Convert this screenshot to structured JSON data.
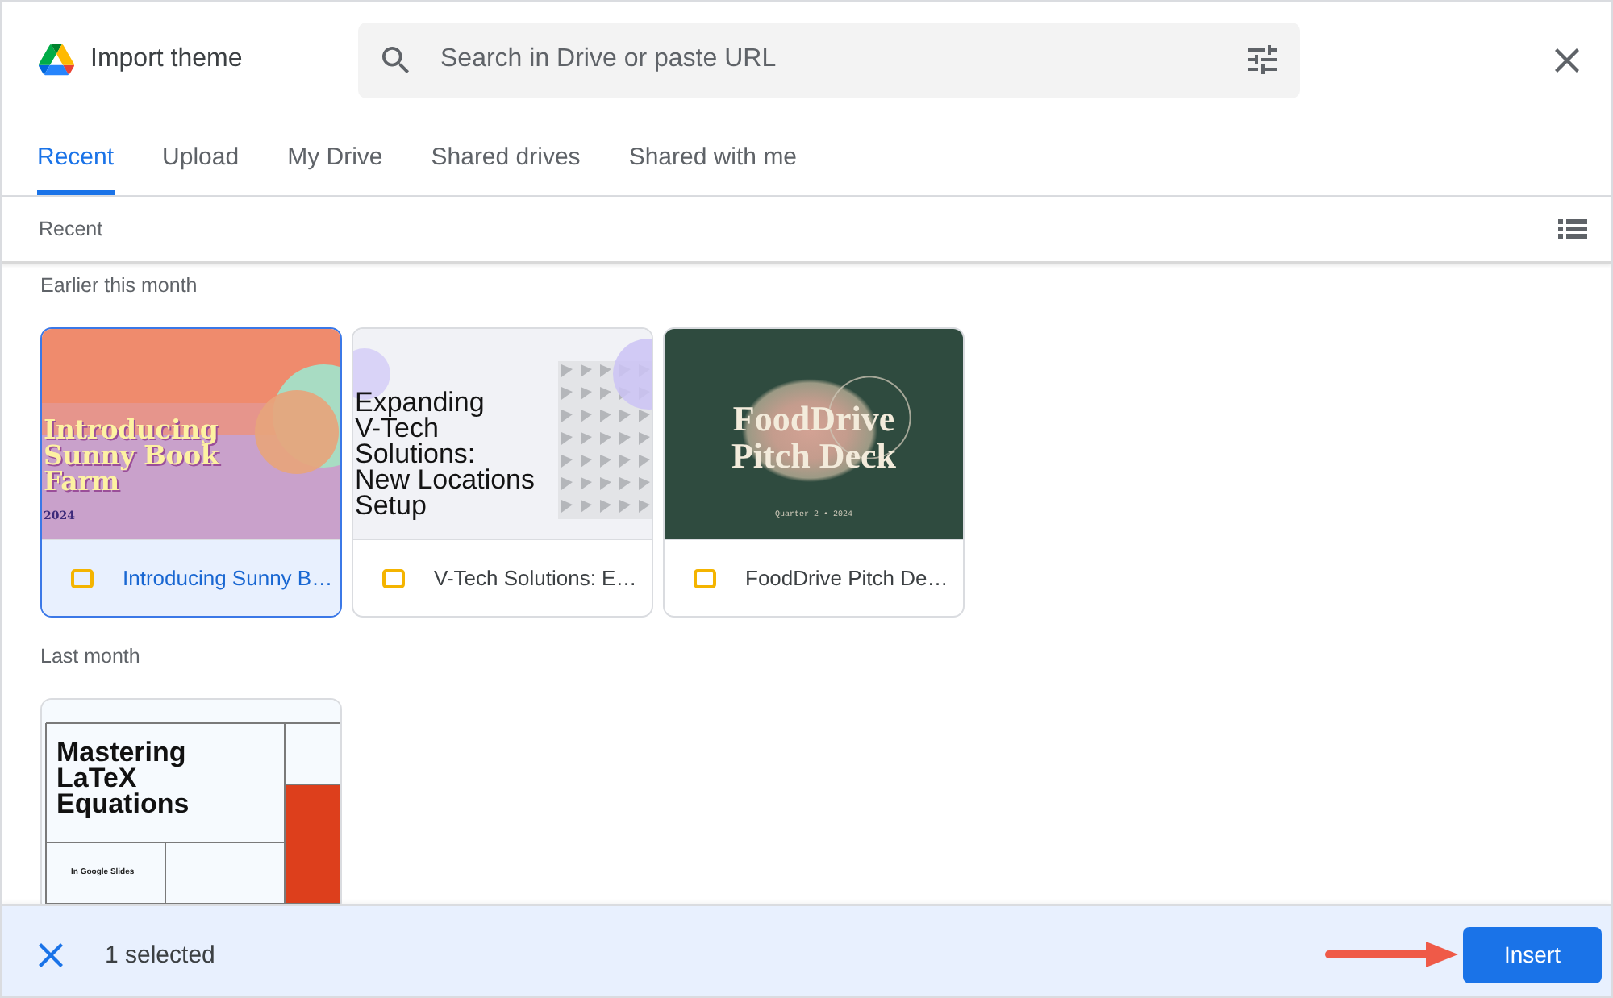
{
  "dialog": {
    "title": "Import theme"
  },
  "search": {
    "placeholder": "Search in Drive or paste URL"
  },
  "tabs": [
    {
      "label": "Recent",
      "selected": true
    },
    {
      "label": "Upload",
      "selected": false
    },
    {
      "label": "My Drive",
      "selected": false
    },
    {
      "label": "Shared drives",
      "selected": false
    },
    {
      "label": "Shared with me",
      "selected": false
    }
  ],
  "breadcrumb": {
    "label": "Recent"
  },
  "sections": [
    {
      "heading": "Earlier this month",
      "files": [
        {
          "name": "Introducing Sunny B…",
          "selected": true,
          "thumbnail": {
            "kind": "sunny",
            "title": "Introducing\nSunny Book\nFarm",
            "subtitle": "2024"
          }
        },
        {
          "name": "V-Tech Solutions: E…",
          "selected": false,
          "thumbnail": {
            "kind": "vtech",
            "title": "Expanding\nV-Tech\nSolutions:\nNew Locations\nSetup"
          }
        },
        {
          "name": "FoodDrive Pitch De…",
          "selected": false,
          "thumbnail": {
            "kind": "fooddrive",
            "title": "FoodDrive\nPitch Deck",
            "subtitle": "Quarter 2 • 2024"
          }
        }
      ]
    },
    {
      "heading": "Last month",
      "files": [
        {
          "selected": false,
          "thumbnail": {
            "kind": "latex",
            "title": "Mastering\nLaTeX\nEquations",
            "subtitle": "In Google Slides"
          }
        }
      ]
    }
  ],
  "selection_bar": {
    "count": "1 selected",
    "action": "Insert"
  }
}
